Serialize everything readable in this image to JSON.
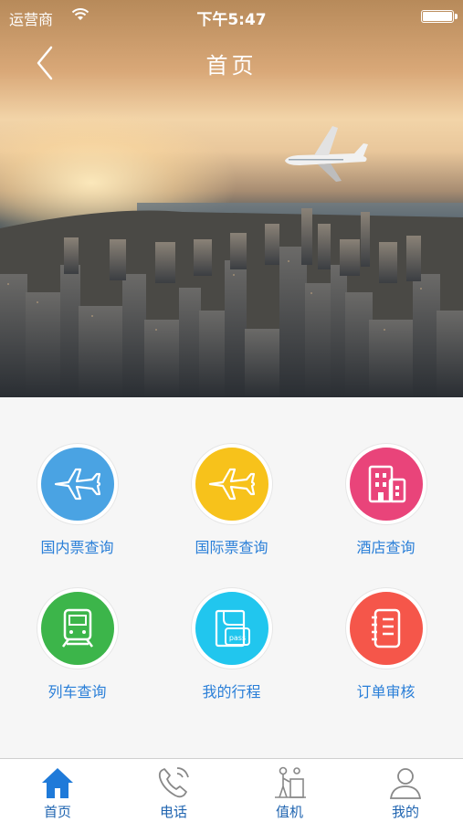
{
  "status_bar": {
    "carrier": "运营商",
    "time": "下午5:47"
  },
  "nav": {
    "title": "首页"
  },
  "menu": [
    {
      "label": "国内票查询",
      "icon": "airplane-icon",
      "color": "#4aa3e3"
    },
    {
      "label": "国际票查询",
      "icon": "airplane-icon",
      "color": "#f7c21b"
    },
    {
      "label": "酒店查询",
      "icon": "hotel-icon",
      "color": "#e9447a"
    },
    {
      "label": "列车查询",
      "icon": "train-icon",
      "color": "#3cb54a"
    },
    {
      "label": "我的行程",
      "icon": "pass-ticket-icon",
      "color": "#21c6ee"
    },
    {
      "label": "订单审核",
      "icon": "notebook-icon",
      "color": "#f5564a"
    }
  ],
  "tabs": [
    {
      "label": "首页",
      "icon": "home-icon",
      "active": true
    },
    {
      "label": "电话",
      "icon": "phone-icon",
      "active": false
    },
    {
      "label": "值机",
      "icon": "check-in-icon",
      "active": false
    },
    {
      "label": "我的",
      "icon": "user-icon",
      "active": false
    }
  ],
  "colors": {
    "accent": "#1f64b0",
    "label_blue": "#2a7fd8"
  }
}
